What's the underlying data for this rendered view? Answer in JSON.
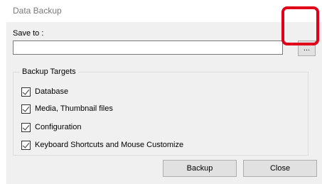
{
  "window": {
    "title": "Data Backup"
  },
  "save": {
    "label": "Save to :",
    "path_value": "",
    "browse_label": "..."
  },
  "targets": {
    "legend": "Backup Targets",
    "items": [
      {
        "label": "Database",
        "checked": true
      },
      {
        "label": "Media, Thumbnail files",
        "checked": true
      },
      {
        "label": "Configuration",
        "checked": true
      },
      {
        "label": "Keyboard Shortcuts and Mouse Customize",
        "checked": true
      }
    ]
  },
  "buttons": {
    "backup_label": "Backup",
    "close_label": "Close"
  },
  "colors": {
    "highlight": "#e0001a",
    "dialog_bg": "#f0f0f0",
    "button_bg": "#e1e1e1"
  }
}
